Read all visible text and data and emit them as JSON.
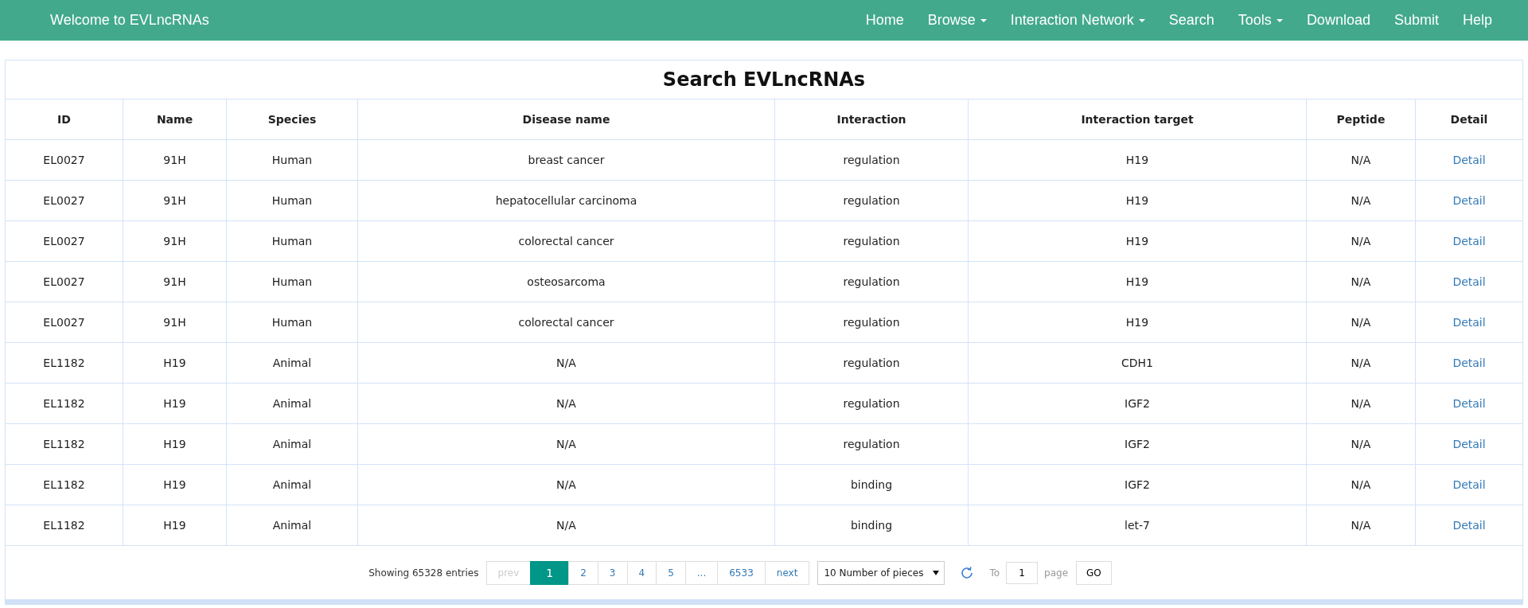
{
  "navbar": {
    "brand": "Welcome to EVLncRNAs",
    "items": [
      {
        "label": "Home",
        "dropdown": false
      },
      {
        "label": "Browse",
        "dropdown": true
      },
      {
        "label": "Interaction Network",
        "dropdown": true
      },
      {
        "label": "Search",
        "dropdown": false
      },
      {
        "label": "Tools",
        "dropdown": true
      },
      {
        "label": "Download",
        "dropdown": false
      },
      {
        "label": "Submit",
        "dropdown": false
      },
      {
        "label": "Help",
        "dropdown": false
      }
    ]
  },
  "title": "Search EVLncRNAs",
  "table": {
    "columns": [
      "ID",
      "Name",
      "Species",
      "Disease name",
      "Interaction",
      "Interaction target",
      "Peptide",
      "Detail"
    ],
    "rows": [
      [
        "EL0027",
        "91H",
        "Human",
        "breast cancer",
        "regulation",
        "H19",
        "N/A",
        "Detail"
      ],
      [
        "EL0027",
        "91H",
        "Human",
        "hepatocellular carcinoma",
        "regulation",
        "H19",
        "N/A",
        "Detail"
      ],
      [
        "EL0027",
        "91H",
        "Human",
        "colorectal cancer",
        "regulation",
        "H19",
        "N/A",
        "Detail"
      ],
      [
        "EL0027",
        "91H",
        "Human",
        "osteosarcoma",
        "regulation",
        "H19",
        "N/A",
        "Detail"
      ],
      [
        "EL0027",
        "91H",
        "Human",
        "colorectal cancer",
        "regulation",
        "H19",
        "N/A",
        "Detail"
      ],
      [
        "EL1182",
        "H19",
        "Animal",
        "N/A",
        "regulation",
        "CDH1",
        "N/A",
        "Detail"
      ],
      [
        "EL1182",
        "H19",
        "Animal",
        "N/A",
        "regulation",
        "IGF2",
        "N/A",
        "Detail"
      ],
      [
        "EL1182",
        "H19",
        "Animal",
        "N/A",
        "regulation",
        "IGF2",
        "N/A",
        "Detail"
      ],
      [
        "EL1182",
        "H19",
        "Animal",
        "N/A",
        "binding",
        "IGF2",
        "N/A",
        "Detail"
      ],
      [
        "EL1182",
        "H19",
        "Animal",
        "N/A",
        "binding",
        "let-7",
        "N/A",
        "Detail"
      ]
    ]
  },
  "pagination": {
    "summary": "Showing 65328 entries",
    "pages": [
      {
        "label": "prev",
        "selected": false,
        "disabled": true
      },
      {
        "label": "1",
        "selected": true,
        "disabled": false
      },
      {
        "label": "2",
        "selected": false,
        "disabled": false
      },
      {
        "label": "3",
        "selected": false,
        "disabled": false
      },
      {
        "label": "4",
        "selected": false,
        "disabled": false
      },
      {
        "label": "5",
        "selected": false,
        "disabled": false
      },
      {
        "label": "...",
        "selected": false,
        "disabled": false
      },
      {
        "label": "6533",
        "selected": false,
        "disabled": false
      },
      {
        "label": "next",
        "selected": false,
        "disabled": false
      }
    ],
    "page_size": "10 Number of pieces",
    "to_label": "To",
    "page_value": "1",
    "page_label": "page",
    "go_button": "GO"
  }
}
